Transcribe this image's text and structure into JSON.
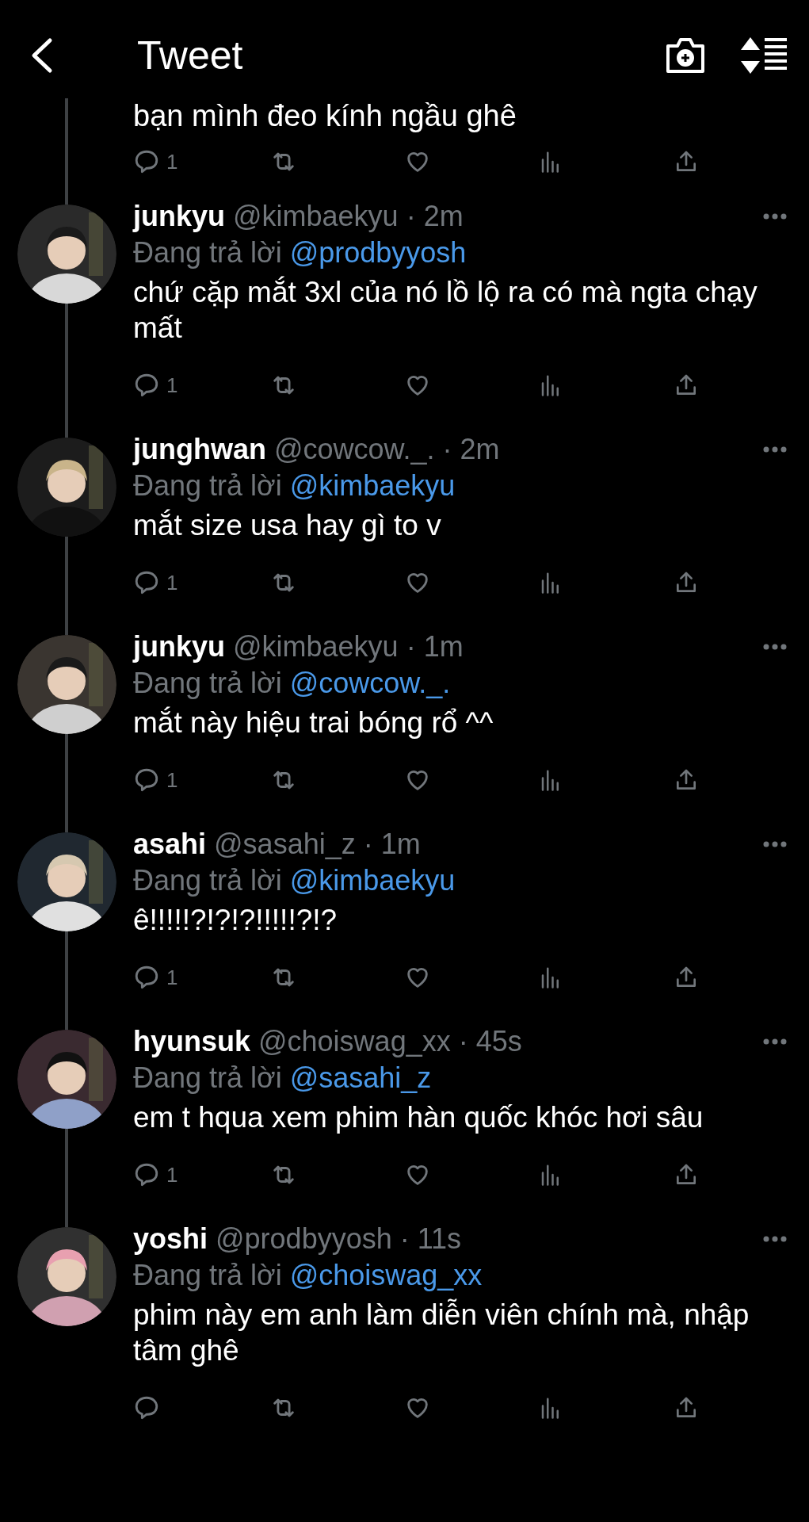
{
  "header": {
    "title": "Tweet"
  },
  "partial_tweet": {
    "text": "bạn mình đeo kính ngầu ghê",
    "reply_count": "1"
  },
  "replies": [
    {
      "name": "junkyu",
      "meta": "@kimbaekyu · 2m",
      "reply_label": "Đang trả lời",
      "reply_to": "@prodbyyosh",
      "text": "chứ cặp mắt 3xl của nó lồ lộ ra có mà ngta chạy mất",
      "reply_count": "1"
    },
    {
      "name": "junghwan",
      "meta": "@cowcow._. · 2m",
      "reply_label": "Đang trả lời",
      "reply_to": "@kimbaekyu",
      "text": "mắt size usa hay gì to v",
      "reply_count": "1"
    },
    {
      "name": "junkyu",
      "meta": "@kimbaekyu · 1m",
      "reply_label": "Đang trả lời",
      "reply_to": "@cowcow._.",
      "text": "mắt này hiệu trai bóng rổ ^^",
      "reply_count": "1"
    },
    {
      "name": "asahi",
      "meta": "@sasahi_z · 1m",
      "reply_label": "Đang trả lời",
      "reply_to": "@kimbaekyu",
      "text": "ê!!!!!?!?!?!!!!!?!?",
      "reply_count": "1"
    },
    {
      "name": "hyunsuk",
      "meta": "@choiswag_xx · 45s",
      "reply_label": "Đang trả lời",
      "reply_to": "@sasahi_z",
      "text": "em t hqua xem phim hàn quốc khóc hơi sâu",
      "reply_count": "1"
    },
    {
      "name": "yoshi",
      "meta": "@prodbyyosh · 11s",
      "reply_label": "Đang trả lời",
      "reply_to": "@choiswag_xx",
      "text": "phim này em anh làm diễn viên chính mà, nhập tâm ghê"
    }
  ]
}
